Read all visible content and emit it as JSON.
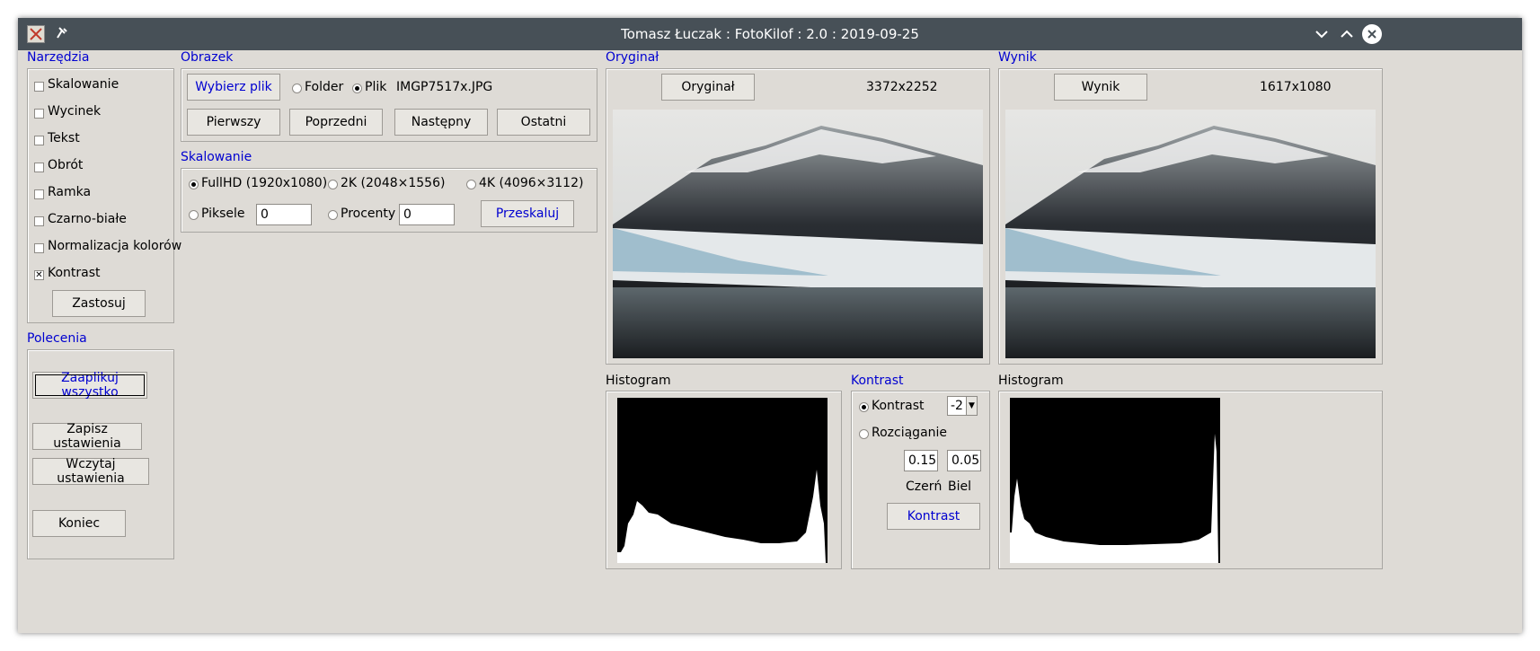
{
  "window": {
    "title": "Tomasz Łuczak : FotoKilof : 2.0 : 2019-09-25"
  },
  "tools": {
    "title": "Narzędzia",
    "items": [
      {
        "label": "Skalowanie",
        "checked": false
      },
      {
        "label": "Wycinek",
        "checked": false
      },
      {
        "label": "Tekst",
        "checked": false
      },
      {
        "label": "Obrót",
        "checked": false
      },
      {
        "label": "Ramka",
        "checked": false
      },
      {
        "label": "Czarno-białe",
        "checked": false
      },
      {
        "label": "Normalizacja kolorów",
        "checked": false
      },
      {
        "label": "Kontrast",
        "checked": true
      }
    ],
    "apply_label": "Zastosuj"
  },
  "commands": {
    "title": "Polecenia",
    "apply_all": "Zaaplikuj wszystko",
    "save": "Zapisz ustawienia",
    "load": "Wczytaj ustawienia",
    "quit": "Koniec"
  },
  "image": {
    "title": "Obrazek",
    "choose": "Wybierz plik",
    "folder": "Folder",
    "file": "Plik",
    "filename": "IMGP7517x.JPG",
    "first": "Pierwszy",
    "prev": "Poprzedni",
    "next": "Następny",
    "last": "Ostatni"
  },
  "scaling": {
    "title": "Skalowanie",
    "fullhd": "FullHD (1920x1080)",
    "k2": "2K (2048×1556)",
    "k4": "4K (4096×3112)",
    "pixels": "Piksele",
    "pixels_value": "0",
    "percent": "Procenty",
    "percent_value": "0",
    "rescale": "Przeskaluj"
  },
  "original": {
    "title": "Oryginał",
    "button": "Oryginał",
    "size": "3372x2252",
    "histogram": "Histogram"
  },
  "result": {
    "title": "Wynik",
    "button": "Wynik",
    "size": "1617x1080",
    "histogram": "Histogram"
  },
  "contrast": {
    "title": "Kontrast",
    "mode_contrast": "Kontrast",
    "value": "-2",
    "mode_stretch": "Rozciąganie",
    "black_value": "0.15",
    "white_value": "0.05",
    "black_label": "Czerń",
    "white_label": "Biel",
    "button": "Kontrast"
  },
  "colors": {
    "accent": "#0000d0",
    "titlebar": "#475057",
    "panel": "#dedbd6"
  }
}
